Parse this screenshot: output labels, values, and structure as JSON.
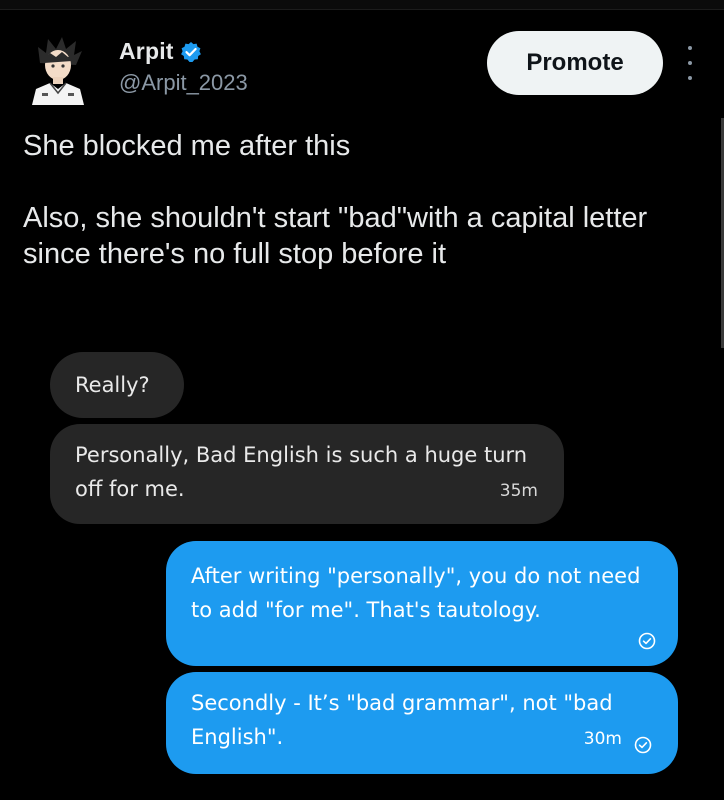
{
  "post": {
    "author_name": "Arpit",
    "author_handle": "@Arpit_2023",
    "promote_label": "Promote",
    "text_line1": "She blocked me after this",
    "text_line2": "Also, she shouldn't start \"bad\"with a capital letter since there's no full stop before it"
  },
  "chat": {
    "messages": [
      {
        "direction": "incoming",
        "text": "Really?"
      },
      {
        "direction": "incoming",
        "text": "Personally, Bad English is such a huge turn off for me.",
        "time": "35m"
      },
      {
        "direction": "outgoing",
        "text": "After writing \"personally\", you do not need to add \"for me\". That's tautology."
      },
      {
        "direction": "outgoing",
        "text": "Secondly - It’s \"bad grammar\", not \"bad English\".",
        "time": "30m"
      }
    ]
  },
  "colors": {
    "background": "#000000",
    "outgoing_bubble": "#1d9bf0",
    "incoming_bubble": "#262626",
    "verified_badge": "#1d9bf0",
    "promote_button": "#eff3f4"
  },
  "icons": [
    "avatar-icon",
    "verified-badge-icon",
    "more-options-icon",
    "seen-check-icon"
  ]
}
